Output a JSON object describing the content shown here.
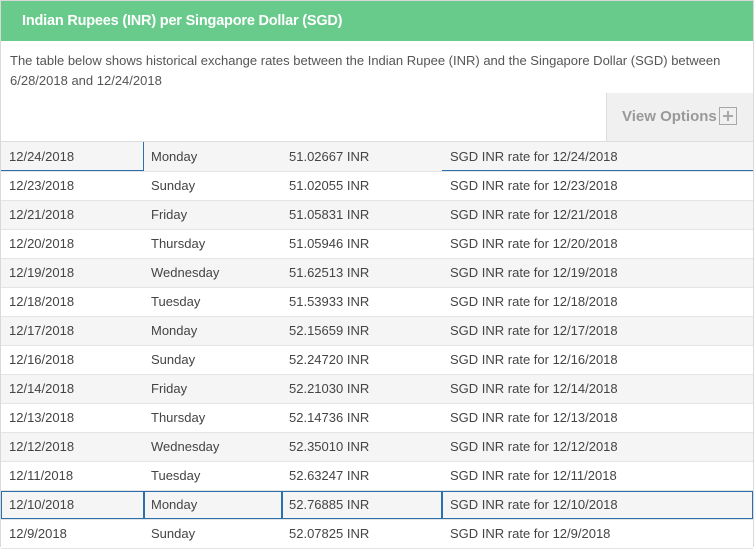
{
  "header": {
    "title": "Indian Rupees (INR) per Singapore Dollar (SGD)"
  },
  "description": "The table below shows historical exchange rates between the Indian Rupee (INR) and the Singapore Dollar (SGD) between 6/28/2018 and 12/24/2018",
  "toolbar": {
    "view_options_label": "View Options",
    "view_options_icon": "plus-icon"
  },
  "colors": {
    "header_bg": "#68cb8c",
    "focus_outline": "#2a6fb0"
  },
  "rows": [
    {
      "date": "12/24/2018",
      "day": "Monday",
      "rate": "51.02667 INR",
      "link": "SGD INR rate for 12/24/2018"
    },
    {
      "date": "12/23/2018",
      "day": "Sunday",
      "rate": "51.02055 INR",
      "link": "SGD INR rate for 12/23/2018"
    },
    {
      "date": "12/21/2018",
      "day": "Friday",
      "rate": "51.05831 INR",
      "link": "SGD INR rate for 12/21/2018"
    },
    {
      "date": "12/20/2018",
      "day": "Thursday",
      "rate": "51.05946 INR",
      "link": "SGD INR rate for 12/20/2018"
    },
    {
      "date": "12/19/2018",
      "day": "Wednesday",
      "rate": "51.62513 INR",
      "link": "SGD INR rate for 12/19/2018"
    },
    {
      "date": "12/18/2018",
      "day": "Tuesday",
      "rate": "51.53933 INR",
      "link": "SGD INR rate for 12/18/2018"
    },
    {
      "date": "12/17/2018",
      "day": "Monday",
      "rate": "52.15659 INR",
      "link": "SGD INR rate for 12/17/2018"
    },
    {
      "date": "12/16/2018",
      "day": "Sunday",
      "rate": "52.24720 INR",
      "link": "SGD INR rate for 12/16/2018"
    },
    {
      "date": "12/14/2018",
      "day": "Friday",
      "rate": "52.21030 INR",
      "link": "SGD INR rate for 12/14/2018"
    },
    {
      "date": "12/13/2018",
      "day": "Thursday",
      "rate": "52.14736 INR",
      "link": "SGD INR rate for 12/13/2018"
    },
    {
      "date": "12/12/2018",
      "day": "Wednesday",
      "rate": "52.35010 INR",
      "link": "SGD INR rate for 12/12/2018"
    },
    {
      "date": "12/11/2018",
      "day": "Tuesday",
      "rate": "52.63247 INR",
      "link": "SGD INR rate for 12/11/2018"
    },
    {
      "date": "12/10/2018",
      "day": "Monday",
      "rate": "52.76885 INR",
      "link": "SGD INR rate for 12/10/2018"
    },
    {
      "date": "12/9/2018",
      "day": "Sunday",
      "rate": "52.07825 INR",
      "link": "SGD INR rate for 12/9/2018"
    }
  ]
}
